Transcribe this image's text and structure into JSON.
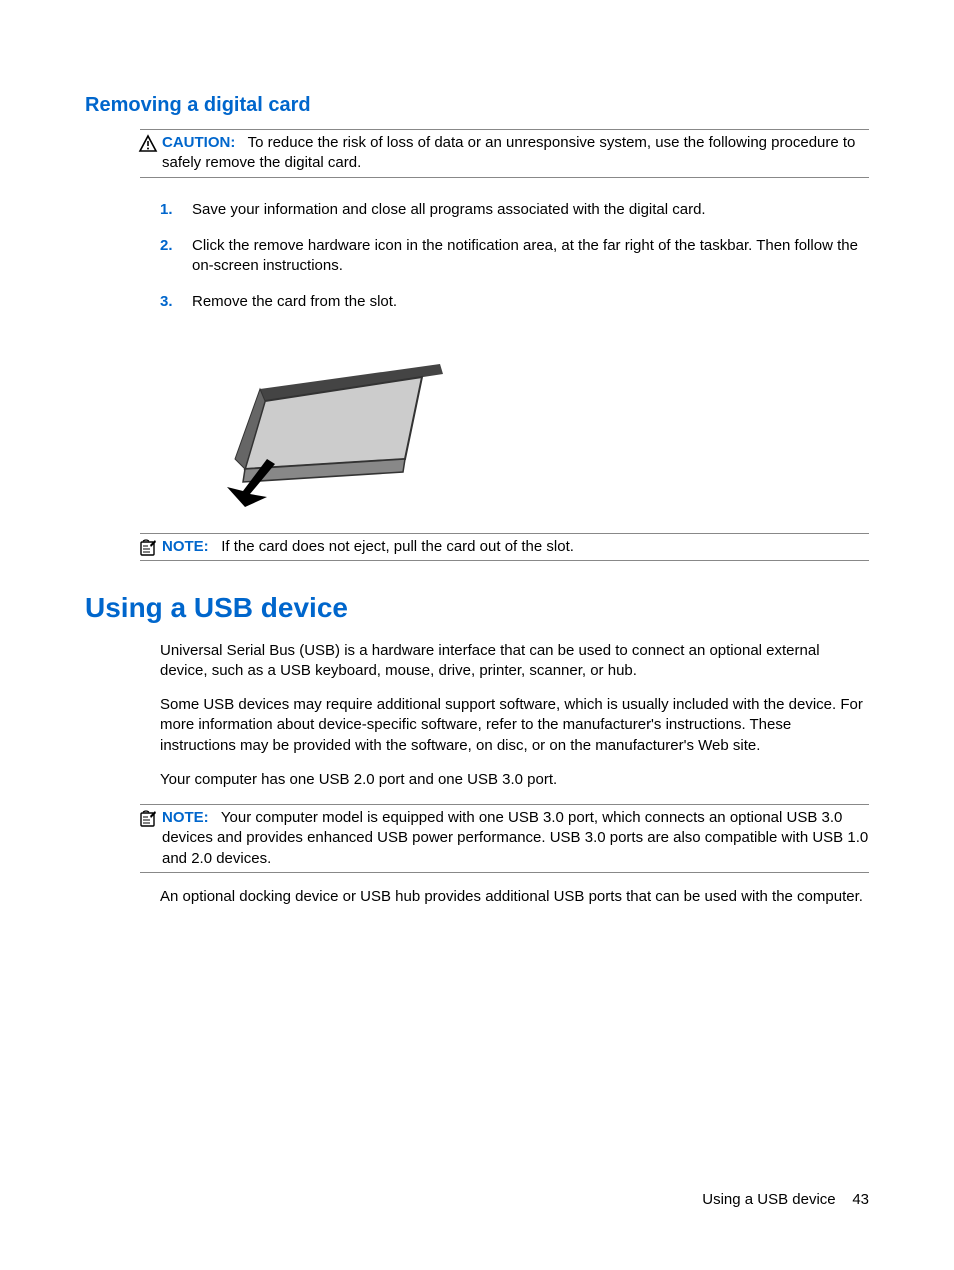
{
  "section1": {
    "heading": "Removing a digital card",
    "caution": {
      "label": "CAUTION:",
      "text": "To reduce the risk of loss of data or an unresponsive system, use the following procedure to safely remove the digital card."
    },
    "steps": [
      "Save your information and close all programs associated with the digital card.",
      "Click the remove hardware icon in the notification area, at the far right of the taskbar. Then follow the on-screen instructions.",
      "Remove the card from the slot."
    ],
    "note": {
      "label": "NOTE:",
      "text": "If the card does not eject, pull the card out of the slot."
    }
  },
  "section2": {
    "heading": "Using a USB device",
    "para1": "Universal Serial Bus (USB) is a hardware interface that can be used to connect an optional external device, such as a USB keyboard, mouse, drive, printer, scanner, or hub.",
    "para2": "Some USB devices may require additional support software, which is usually included with the device. For more information about device-specific software, refer to the manufacturer's instructions. These instructions may be provided with the software, on disc, or on the manufacturer's Web site.",
    "para3": "Your computer has one USB 2.0 port and one USB 3.0 port.",
    "note": {
      "label": "NOTE:",
      "text": "Your computer model is equipped with one USB 3.0 port, which connects an optional USB 3.0 devices and provides enhanced USB power performance. USB 3.0 ports are also compatible with USB 1.0 and 2.0 devices."
    },
    "para4": "An optional docking device or USB hub provides additional USB ports that can be used with the computer."
  },
  "footer": {
    "label": "Using a USB device",
    "page": "43"
  }
}
